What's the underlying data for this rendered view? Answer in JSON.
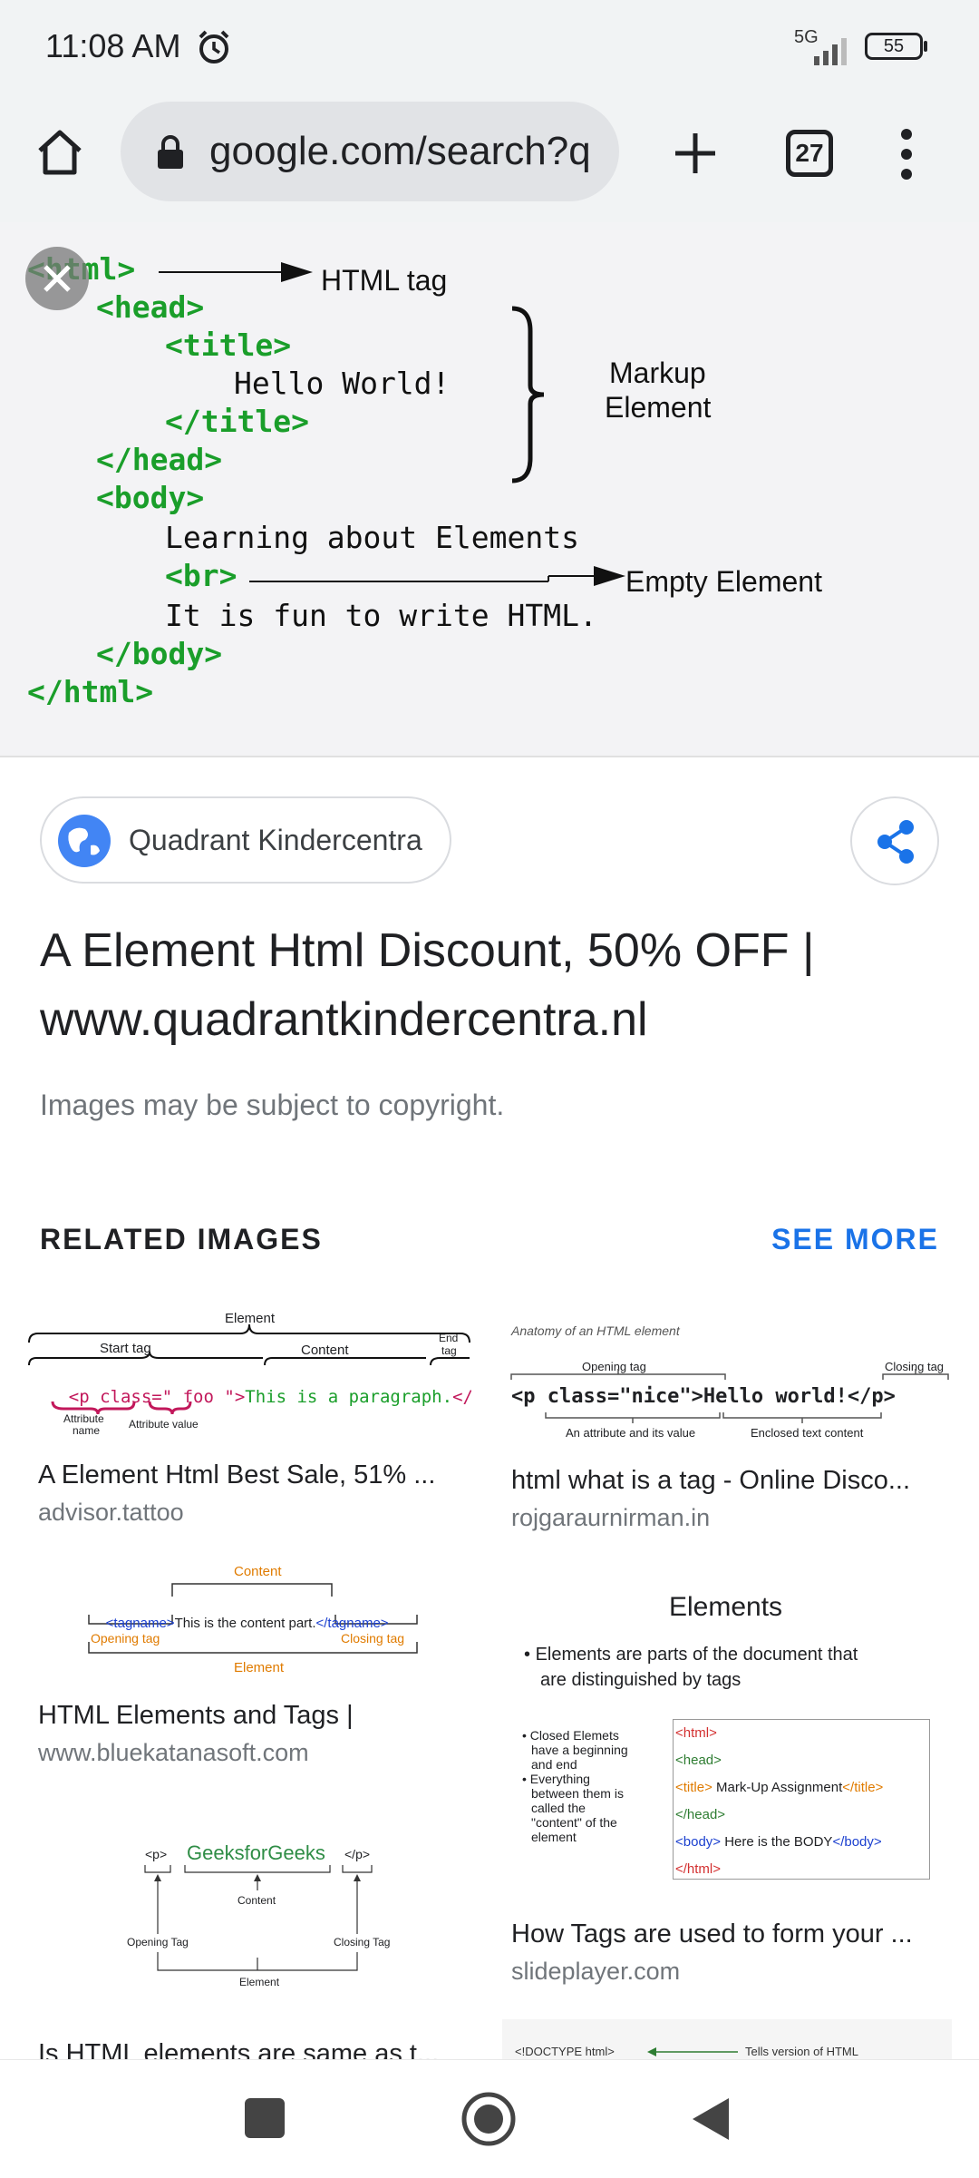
{
  "status": {
    "time": "11:08 AM",
    "network": "5G",
    "battery": "55"
  },
  "browser": {
    "url": "google.com/search?q",
    "tab_count": "27",
    "icons": [
      "home-icon",
      "lock-icon",
      "add-tab-icon",
      "menu-icon"
    ]
  },
  "preview": {
    "code_lines": [
      "<html>",
      "<head>",
      "<title>",
      "Hello World!",
      "</title>",
      "</head>",
      "<body>",
      "Learning about Elements",
      "<br>",
      "It is fun to write HTML.",
      "</body>",
      "</html>"
    ],
    "annotations": {
      "html_tag": "HTML tag",
      "markup_1": "Markup",
      "markup_2": "Element",
      "empty": "Empty Element"
    }
  },
  "source_chip": {
    "label": "Quadrant Kindercentra"
  },
  "result": {
    "title": "A Element Html Discount, 50% OFF | www.quadrantkindercentra.nl",
    "copyright": "Images may be subject to copyright."
  },
  "related": {
    "heading": "RELATED IMAGES",
    "see_more": "SEE MORE",
    "items": [
      {
        "title": "A Element Html Best Sale, 51% ...",
        "source": "advisor.tattoo",
        "thumb": {
          "element": "Element",
          "start_tag": "Start tag",
          "content": "Content",
          "end_tag_1": "End",
          "end_tag_2": "tag",
          "code_tag": "<p class=\"",
          "code_foo": "foo",
          "code_quote": "\">",
          "code_content": "This is a paragraph.",
          "code_close": "</p>",
          "attr_1": "Attribute",
          "attr_2": "name",
          "attr_value": "Attribute value"
        }
      },
      {
        "title": "html what is a tag - Online Disco...",
        "source": "rojgaraurnirman.in",
        "thumb": {
          "caption": "Anatomy of an HTML element",
          "opening": "Opening tag",
          "closing": "Closing tag",
          "code": "<p class=\"nice\">Hello world!</p>",
          "attr": "An attribute and its value",
          "enclosed": "Enclosed text content"
        }
      },
      {
        "title": "HTML Elements and Tags |",
        "source": "www.bluekatanasoft.com",
        "thumb": {
          "content": "Content",
          "open": "<tagname>",
          "text": "This is the content part.",
          "close": "</tagname>",
          "opening": "Opening tag",
          "closing": "Closing tag",
          "element": "Element"
        }
      },
      {
        "title": "How Tags are used to form your ...",
        "source": "slideplayer.com",
        "thumb": {
          "heading": "Elements",
          "bullet1_a": "Elements are parts of the document that",
          "bullet1_b": "are distinguished by tags",
          "b2_1": "Closed Elemets",
          "b2_2": "have a beginning",
          "b2_3": "and end",
          "b3_1": "Everything",
          "b3_2": "between them is",
          "b3_3": "called the",
          "b3_4": "\"content\" of the",
          "b3_5": "element",
          "c_html": "<html>",
          "c_head": "<head>",
          "c_title_open": "<title>",
          "c_title_text": " Mark-Up Assignment",
          "c_title_close": "</title>",
          "c_head_close": "</head>",
          "c_body_open": "<body>",
          "c_body_text": " Here is the BODY",
          "c_body_close": "</body>",
          "c_html_close": "</html>"
        }
      },
      {
        "title": "Is HTML elements are same as t...",
        "source": "",
        "thumb": {
          "p_open": "<p>",
          "brand": "GeeksforGeeks",
          "p_close": "</p>",
          "opening": "Opening Tag",
          "content": "Content",
          "closing": "Closing Tag",
          "element": "Element"
        }
      },
      {
        "title": "",
        "source": "",
        "thumb": {
          "doctype": "<!DOCTYPE html>",
          "note": "Tells version of HTML"
        }
      }
    ]
  },
  "colors": {
    "accent": "#1a73e8",
    "chrome": "#f1f3f4",
    "code_green": "#1a9e2a"
  }
}
